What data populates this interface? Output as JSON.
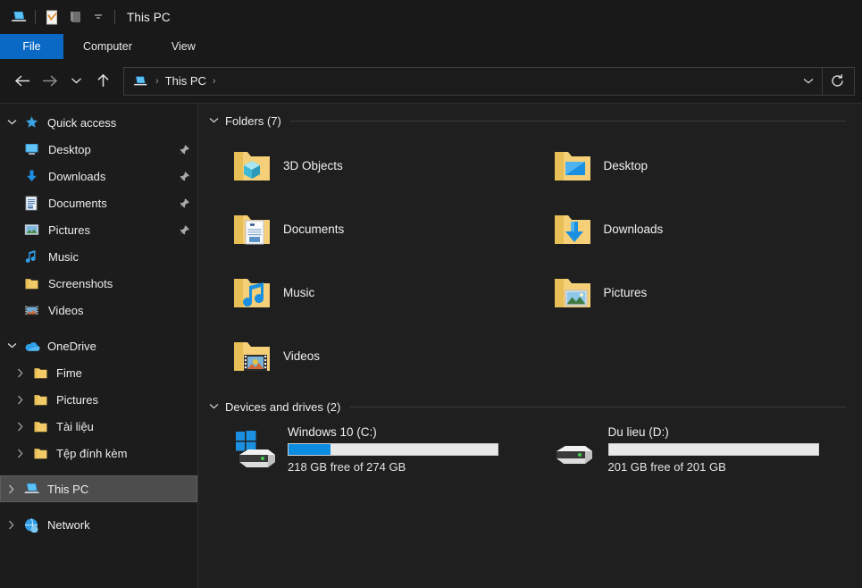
{
  "titlebar": {
    "title": "This PC",
    "quick_access_icons": [
      "this-pc-icon",
      "properties-icon",
      "folder-icon",
      "customize-chevron-icon"
    ]
  },
  "ribbon": {
    "tabs": [
      {
        "label": "File",
        "active": true
      },
      {
        "label": "Computer",
        "active": false
      },
      {
        "label": "View",
        "active": false
      }
    ]
  },
  "navigation": {
    "back_icon": "back-arrow-icon",
    "forward_icon": "forward-arrow-icon",
    "recent_icon": "chevron-down-icon",
    "up_icon": "up-arrow-icon",
    "address": {
      "icon": "this-pc-icon",
      "crumb": "This PC",
      "separator": "›"
    },
    "dropdown_icon": "chevron-down-icon",
    "refresh_icon": "refresh-icon"
  },
  "sidebar": {
    "groups": [
      {
        "label": "Quick access",
        "icon": "pin-star-icon",
        "expanded": true,
        "items": [
          {
            "label": "Desktop",
            "icon": "desktop-icon",
            "pinned": true
          },
          {
            "label": "Downloads",
            "icon": "downloads-icon",
            "pinned": true
          },
          {
            "label": "Documents",
            "icon": "documents-icon",
            "pinned": true
          },
          {
            "label": "Pictures",
            "icon": "pictures-icon",
            "pinned": true
          },
          {
            "label": "Music",
            "icon": "music-icon",
            "pinned": false
          },
          {
            "label": "Screenshots",
            "icon": "folder-icon",
            "pinned": false
          },
          {
            "label": "Videos",
            "icon": "videos-icon",
            "pinned": false
          }
        ]
      },
      {
        "label": "OneDrive",
        "icon": "onedrive-cloud-icon",
        "expanded": true,
        "items": [
          {
            "label": "Fime",
            "icon": "folder-icon",
            "pinned": false,
            "collapsible": true
          },
          {
            "label": "Pictures",
            "icon": "folder-icon",
            "pinned": false,
            "collapsible": true
          },
          {
            "label": "Tài liệu",
            "icon": "folder-icon",
            "pinned": false,
            "collapsible": true
          },
          {
            "label": "Tệp đính kèm",
            "icon": "folder-icon",
            "pinned": false,
            "collapsible": true
          }
        ]
      }
    ],
    "roots": [
      {
        "label": "This PC",
        "icon": "this-pc-icon",
        "selected": true
      },
      {
        "label": "Network",
        "icon": "network-icon",
        "selected": false
      }
    ]
  },
  "content": {
    "folders_section": {
      "label": "Folders (7)",
      "items": [
        {
          "name": "3D Objects",
          "icon": "3d-objects-folder-icon"
        },
        {
          "name": "Desktop",
          "icon": "desktop-folder-icon"
        },
        {
          "name": "Documents",
          "icon": "documents-folder-icon"
        },
        {
          "name": "Downloads",
          "icon": "downloads-folder-icon"
        },
        {
          "name": "Music",
          "icon": "music-folder-icon"
        },
        {
          "name": "Pictures",
          "icon": "pictures-folder-icon"
        },
        {
          "name": "Videos",
          "icon": "videos-folder-icon"
        }
      ]
    },
    "drives_section": {
      "label": "Devices and drives (2)",
      "items": [
        {
          "name": "Windows 10 (C:)",
          "icon": "windows-drive-icon",
          "free_text": "218 GB free of 274 GB",
          "used_percent": 20
        },
        {
          "name": "Du lieu (D:)",
          "icon": "hard-drive-icon",
          "free_text": "201 GB free of 201 GB",
          "used_percent": 0
        }
      ]
    }
  },
  "colors": {
    "accent": "#0a69c4",
    "bar_fill": "#0c8ce0",
    "selection": "#4d4d4d",
    "window_bg": "#191919",
    "content_bg": "#1f1f1f",
    "sidebar_bg": "#1c1c1c"
  }
}
